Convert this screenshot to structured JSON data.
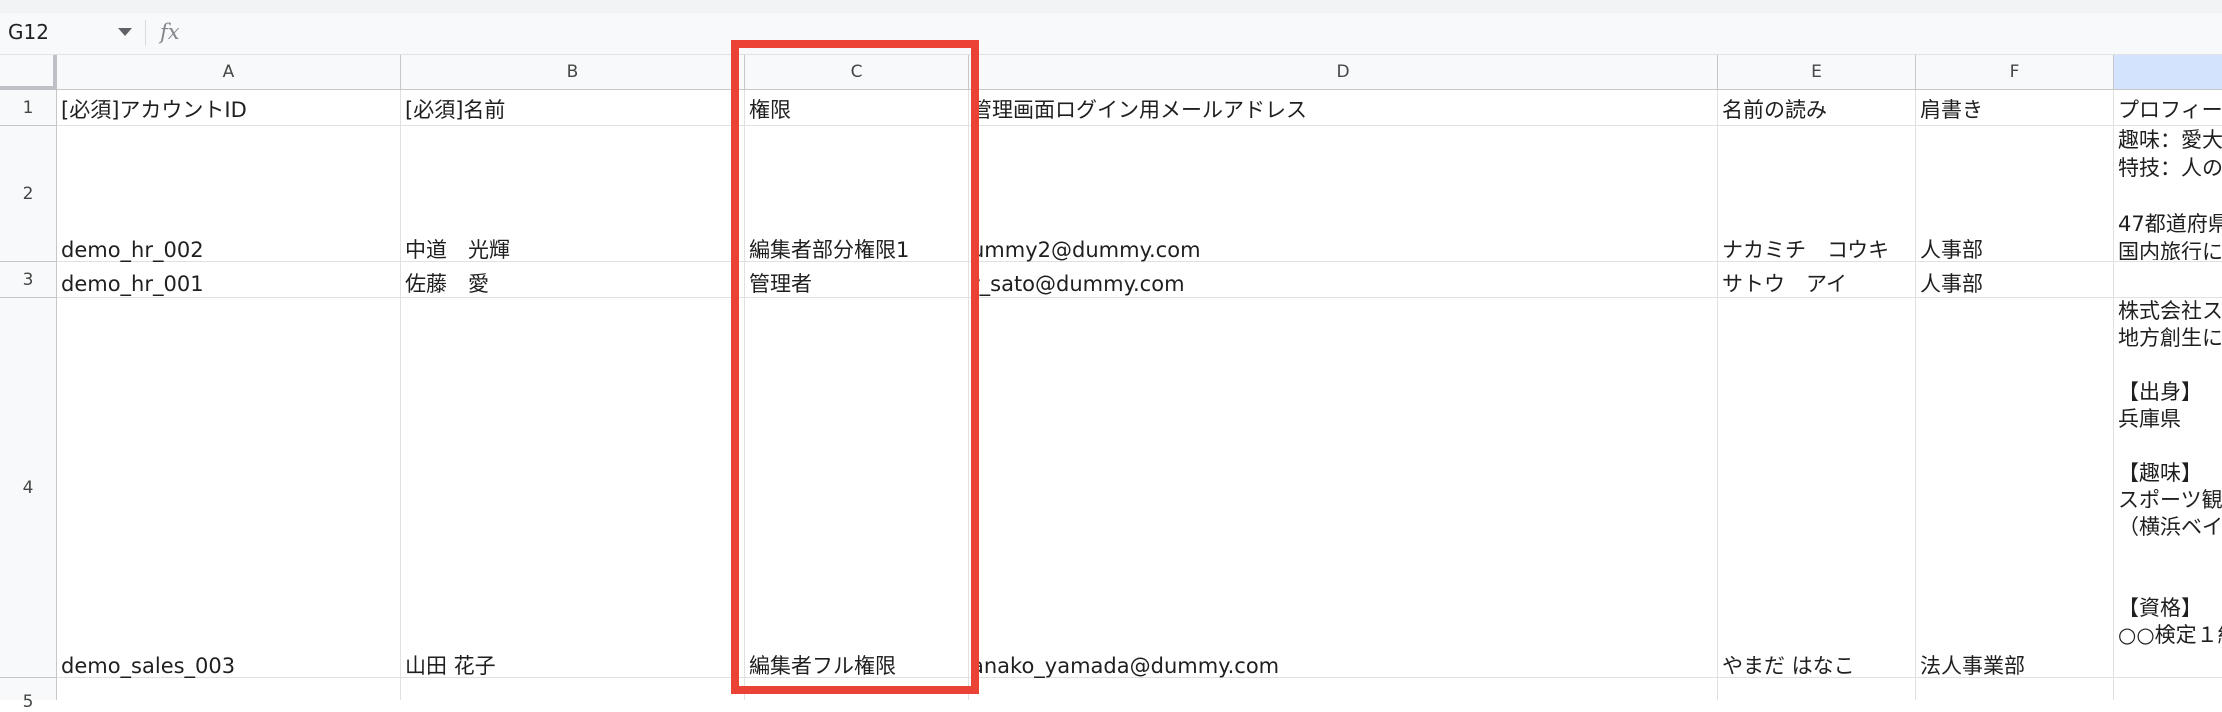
{
  "formula_bar": {
    "cell_ref": "G12",
    "fx_label": "fx"
  },
  "columns": [
    "A",
    "B",
    "C",
    "D",
    "E",
    "F"
  ],
  "row_numbers": [
    "1",
    "2",
    "3",
    "4",
    "5"
  ],
  "rows": [
    [
      "[必須]アカウントID",
      "[必須]名前",
      "権限",
      "管理画面ログイン用メールアドレス",
      "名前の読み",
      "肩書き",
      "プロフィー"
    ],
    [
      "demo_hr_002",
      "中道　光輝",
      "編集者部分権限1",
      "ummy2@dummy.com",
      "ナカミチ　コウキ",
      "人事部",
      "趣味：愛大\n特技：人の\n\n47都道府県\n国内旅行に"
    ],
    [
      "demo_hr_001",
      "佐藤　愛",
      "管理者",
      "r_sato@dummy.com",
      "サトウ　アイ",
      "人事部",
      ""
    ],
    [
      "demo_sales_003",
      "山田 花子",
      "編集者フル権限",
      "anako_yamada@dummy.com",
      "やまだ はなこ",
      "法人事業部",
      "株式会社ス\n地方創生に\n\n【出身】\n兵庫県\n\n【趣味】\nスポーツ観\n（横浜ベイ\n\n\n【資格】\n○○検定１級"
    ]
  ]
}
